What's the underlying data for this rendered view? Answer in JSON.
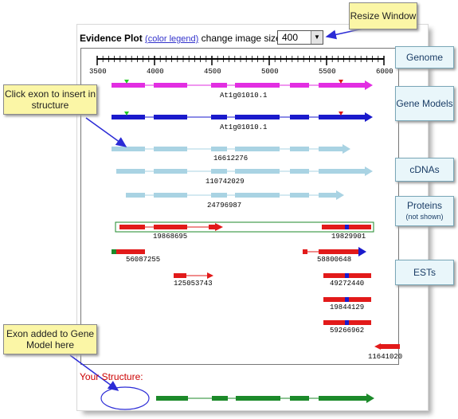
{
  "header": {
    "title": "Evidence Plot",
    "legend_link": "(color legend)",
    "size_label": "change image size to",
    "size_value": "400"
  },
  "axis": {
    "ticks": [
      "3500",
      "4000",
      "4500",
      "5000",
      "5500",
      "6000"
    ]
  },
  "tracks": {
    "gene_model_1": "At1g01010.1",
    "gene_model_2": "At1g01010.1",
    "cdna_1": "16612276",
    "cdna_2": "110742029",
    "cdna_3": "24796987",
    "protein_1": "19868695",
    "protein_2": "19829901",
    "est_1": "56087255",
    "est_2": "58800648",
    "est_3": "125053743",
    "est_4": "49272440",
    "est_5": "19844129",
    "est_6": "59266962",
    "est_7": "11641020"
  },
  "your_structure_label": "Your Structure:",
  "callouts": {
    "resize": "Resize Window",
    "click_exon": "Click exon to insert in structure",
    "exon_added": "Exon added to Gene Model here"
  },
  "legend": {
    "genome": "Genome",
    "gene_models": "Gene Models",
    "cdnas": "cDNAs",
    "proteins": "Proteins",
    "proteins_note": "(not shown)",
    "ests": "ESTs"
  },
  "colors": {
    "gene_model_magenta": "#e22ee2",
    "gene_model_blue": "#1a1acc",
    "cdna": "#a9d3e3",
    "protein_est": "#e21a1a",
    "structure": "#1c8a2a",
    "callout_arrow": "#2b2bd6"
  }
}
